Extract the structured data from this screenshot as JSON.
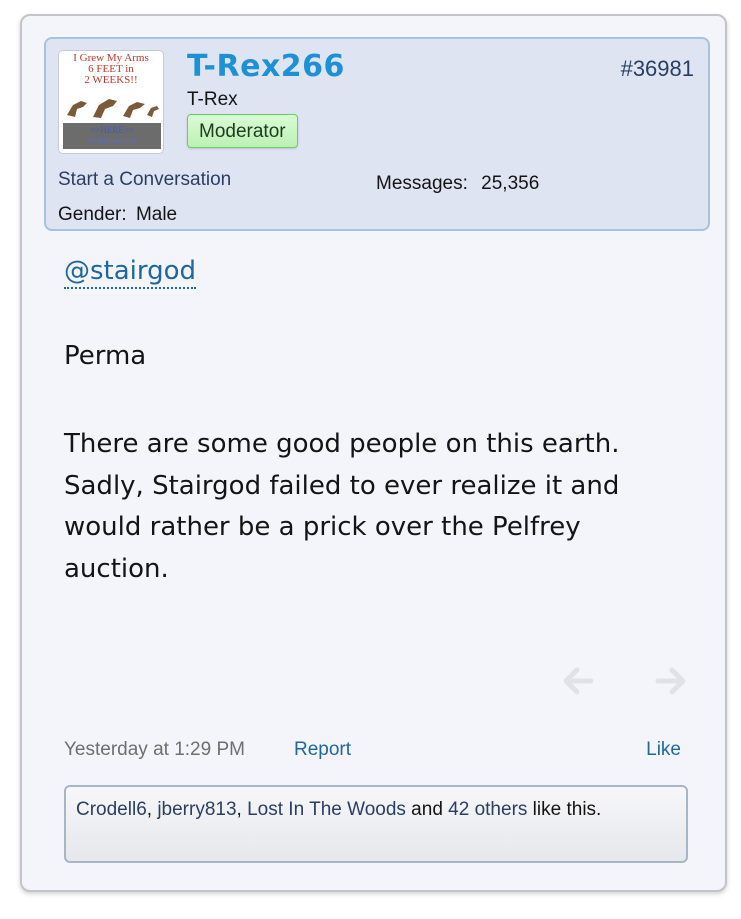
{
  "user": {
    "name": "T-Rex266",
    "title": "T-Rex",
    "badge": "Moderator",
    "start_conversation": "Start a Conversation",
    "messages_label": "Messages:",
    "messages_value": "25,356",
    "gender_label": "Gender:",
    "gender_value": "Male",
    "avatar": {
      "line1": "I Grew My Arms",
      "line2": "6 FEET in",
      "line3": "2 WEEKS!!",
      "banner": ">>HERE<<",
      "banner_sub": "To find out how!"
    }
  },
  "post": {
    "number": "#36981",
    "mention": "@stairgod",
    "para1": "Perma",
    "para2": "There are some good people on this earth. Sadly, Stairgod failed to ever realize it and would rather be a prick over the Pelfrey auction.",
    "timestamp": "Yesterday at 1:29 PM",
    "report": "Report",
    "like": "Like",
    "prev_icon": "arrow-left-icon",
    "next_icon": "arrow-right-icon"
  },
  "likes": {
    "user1": "Crodell6",
    "sep1": ", ",
    "user2": "jberry813",
    "sep2": ", ",
    "user3": "Lost In The Woods",
    "and": " and ",
    "others": "42 others",
    "suffix": " like this."
  },
  "colors": {
    "username": "#1e90d6",
    "link": "#1f67a0",
    "badge_bg": "#d9fcd4",
    "userbox_bg": "#dfe4f3"
  }
}
